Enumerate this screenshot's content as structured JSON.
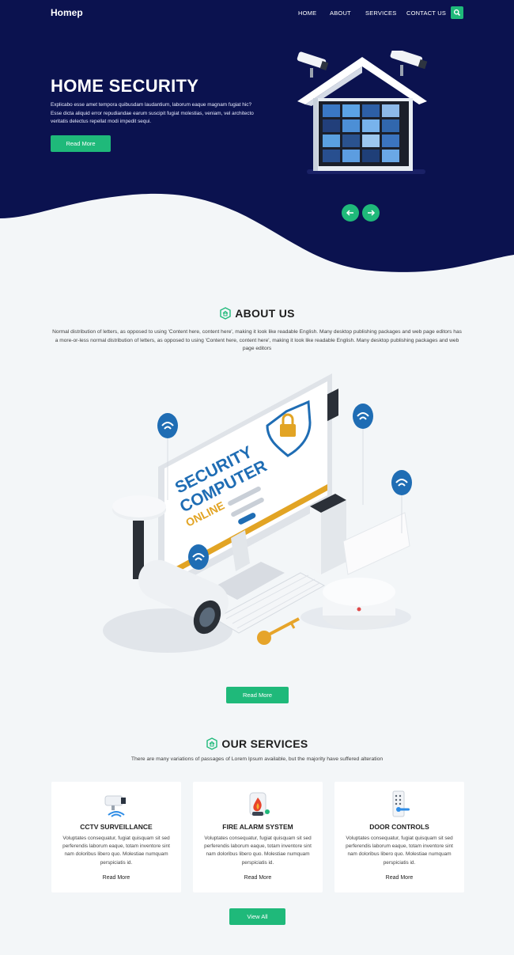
{
  "nav": {
    "brand": "Homep",
    "links": [
      "HOME",
      "ABOUT",
      "SERVICES",
      "CONTACT US"
    ]
  },
  "hero": {
    "title": "HOME SECURITY",
    "text": "Explicabo esse amet tempora quibusdam laudantium, laborum eaque magnam fugiat hic? Esse dicta aliquid error repudiandae earum suscipit fugiat molestias, veniam, vel architecto veritatis delectus repellat modi impedit sequi.",
    "button": "Read More"
  },
  "about": {
    "title": "ABOUT US",
    "text": "Normal distribution of letters, as opposed to using 'Content here, content here', making it look like readable English. Many desktop publishing packages and web page editors has a more-or-less normal distribution of letters, as opposed to using 'Content here, content here', making it look like readable English. Many desktop publishing packages and web page editors",
    "illustration": {
      "line1": "SECURITY",
      "line2": "COMPUTER",
      "line3": "ONLINE"
    },
    "button": "Read More"
  },
  "services": {
    "title": "OUR SERVICES",
    "subtitle": "There are many variations of passages of Lorem Ipsum available, but the majority have suffered alteration",
    "cards": [
      {
        "title": "CCTV SURVEILLANCE",
        "text": "Voluptates consequatur, fugiat quisquam sit sed perferendis laborum eaque, totam inventore sint nam doloribus libero quo. Molestiae numquam perspiciatis id.",
        "link": "Read More"
      },
      {
        "title": "FIRE ALARM SYSTEM",
        "text": "Voluptates consequatur, fugiat quisquam sit sed perferendis laborum eaque, totam inventore sint nam doloribus libero quo. Molestiae numquam perspiciatis id.",
        "link": "Read More"
      },
      {
        "title": "DOOR CONTROLS",
        "text": "Voluptates consequatur, fugiat quisquam sit sed perferendis laborum eaque, totam inventore sint nam doloribus libero quo. Molestiae numquam perspiciatis id.",
        "link": "Read More"
      }
    ],
    "button": "View All"
  },
  "colors": {
    "navy": "#0b124f",
    "green": "#1fb97a",
    "page_bg": "#f3f6f8",
    "accent_blue": "#1e6db4",
    "accent_orange": "#f2a51a"
  }
}
